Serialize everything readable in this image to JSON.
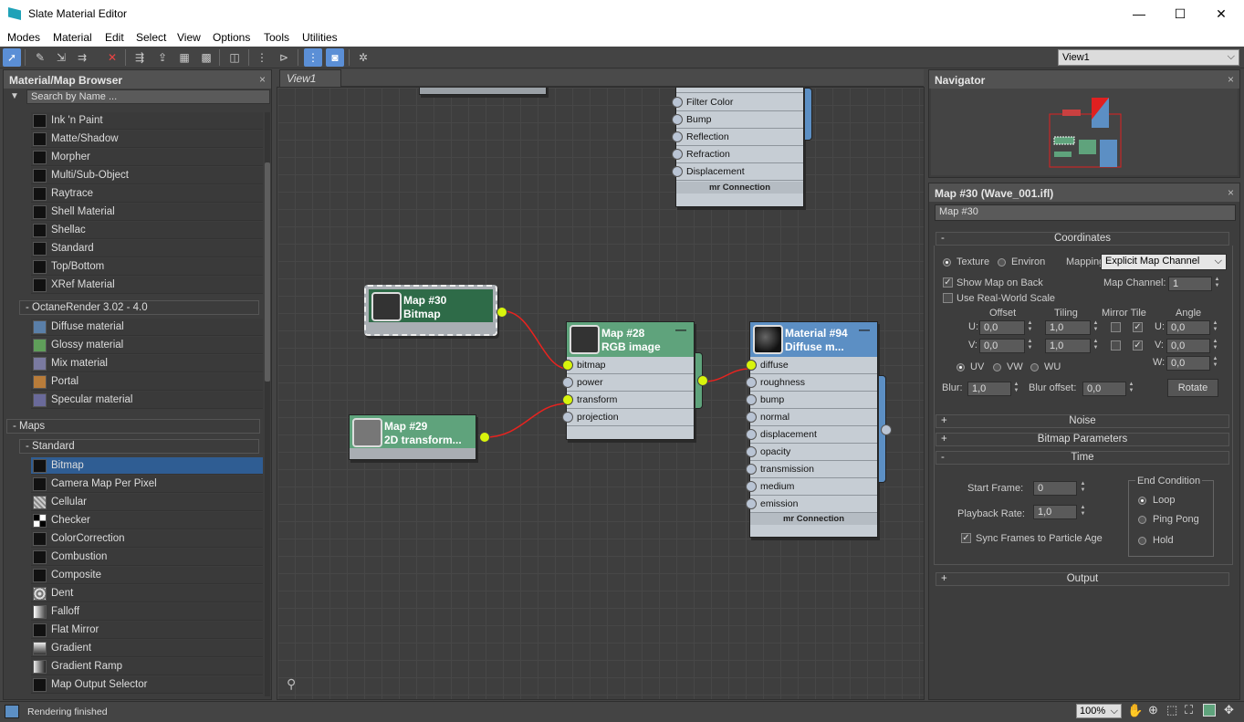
{
  "window": {
    "title": "Slate Material Editor",
    "minimize": "—",
    "maximize": "☐",
    "close": "✕"
  },
  "menu": [
    "Modes",
    "Material",
    "Edit",
    "Select",
    "View",
    "Options",
    "Tools",
    "Utilities"
  ],
  "toolbar": {
    "view_select": "View1"
  },
  "browser": {
    "title": "Material/Map Browser",
    "search_placeholder": "Search by Name ...",
    "materials": [
      "Ink 'n Paint",
      "Matte/Shadow",
      "Morpher",
      "Multi/Sub-Object",
      "Raytrace",
      "Shell Material",
      "Shellac",
      "Standard",
      "Top/Bottom",
      "XRef Material"
    ],
    "octane_group": "- OctaneRender 3.02 - 4.0",
    "octane": [
      "Diffuse material",
      "Glossy material",
      "Mix material",
      "Portal",
      "Specular material"
    ],
    "maps_group": "- Maps",
    "standard_group": "- Standard",
    "maps": [
      "Bitmap",
      "Camera Map Per Pixel",
      "Cellular",
      "Checker",
      "ColorCorrection",
      "Combustion",
      "Composite",
      "Dent",
      "Falloff",
      "Flat Mirror",
      "Gradient",
      "Gradient Ramp",
      "Map Output Selector"
    ],
    "selected_map": "Bitmap"
  },
  "view": {
    "tab": "View1",
    "top_node_slots": [
      "Filter Color",
      "Bump",
      "Reflection",
      "Refraction",
      "Displacement"
    ],
    "top_node_footer": "mr Connection",
    "node30": {
      "title": "Map #30",
      "subtitle": "Bitmap"
    },
    "node29": {
      "title": "Map #29",
      "subtitle": "2D transform..."
    },
    "node28": {
      "title": "Map #28",
      "subtitle": "RGB image",
      "slots": [
        "bitmap",
        "power",
        "transform",
        "projection"
      ]
    },
    "node94": {
      "title": "Material #94",
      "subtitle": "Diffuse m...",
      "slots": [
        "diffuse",
        "roughness",
        "bump",
        "normal",
        "displacement",
        "opacity",
        "transmission",
        "medium",
        "emission"
      ],
      "footer": "mr Connection"
    }
  },
  "navigator": {
    "title": "Navigator"
  },
  "properties": {
    "title": "Map #30 (Wave_001.ifl)",
    "name_value": "Map #30",
    "coordinates": {
      "header": "Coordinates",
      "texture": "Texture",
      "environ": "Environ",
      "mapping_label": "Mapping:",
      "mapping_value": "Explicit Map Channel",
      "show_map": "Show Map on Back",
      "map_channel_label": "Map Channel:",
      "map_channel_value": "1",
      "real_world": "Use Real-World Scale",
      "offset": "Offset",
      "tiling": "Tiling",
      "mirror_tile": "Mirror Tile",
      "angle": "Angle",
      "u": "U:",
      "v": "V:",
      "w": "W:",
      "u_offset": "0,0",
      "v_offset": "0,0",
      "u_tiling": "1,0",
      "v_tiling": "1,0",
      "u_angle": "0,0",
      "v_angle": "0,0",
      "w_angle": "0,0",
      "uv": "UV",
      "vw": "VW",
      "wu": "WU",
      "blur_label": "Blur:",
      "blur_value": "1,0",
      "blur_offset_label": "Blur offset:",
      "blur_offset_value": "0,0",
      "rotate": "Rotate"
    },
    "noise": "Noise",
    "bitmap_params": "Bitmap Parameters",
    "time": {
      "header": "Time",
      "start_frame_label": "Start Frame:",
      "start_frame_value": "0",
      "playback_label": "Playback Rate:",
      "playback_value": "1,0",
      "sync": "Sync Frames to Particle Age",
      "end_condition": "End Condition",
      "loop": "Loop",
      "ping_pong": "Ping Pong",
      "hold": "Hold"
    },
    "output": "Output"
  },
  "status": {
    "text": "Rendering finished",
    "zoom": "100%"
  }
}
